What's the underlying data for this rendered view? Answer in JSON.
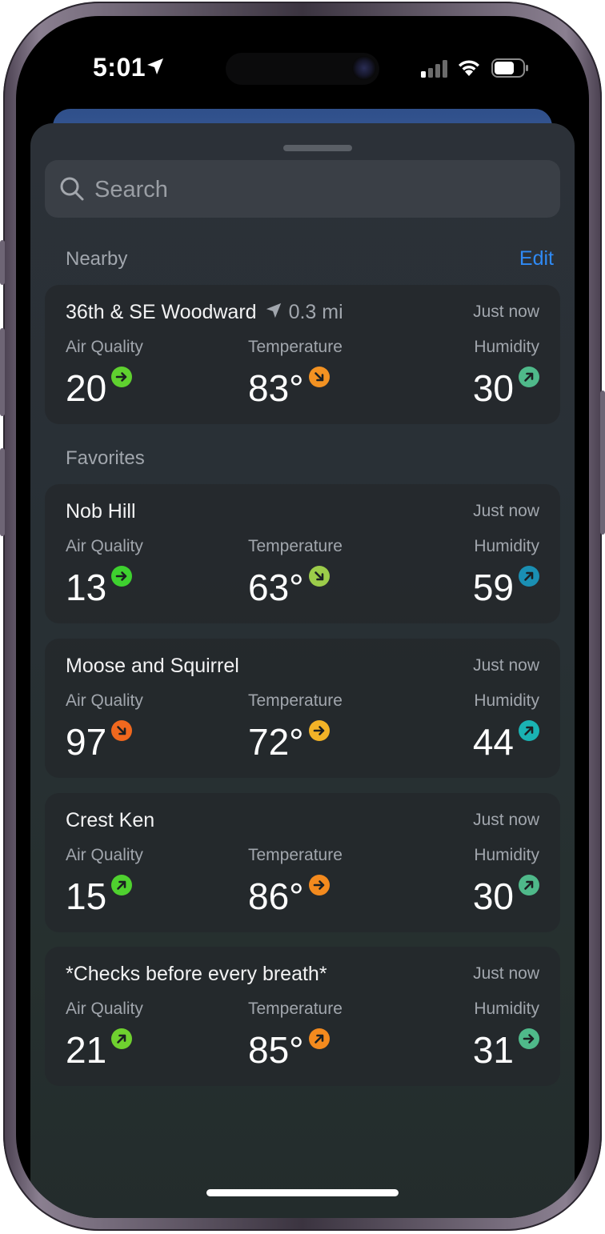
{
  "status": {
    "time": "5:01"
  },
  "search": {
    "placeholder": "Search"
  },
  "nearby": {
    "title": "Nearby",
    "edit_label": "Edit",
    "location": {
      "name": "36th & SE Woodward",
      "distance": "0.3 mi",
      "updated": "Just now",
      "air_quality": {
        "label": "Air Quality",
        "value": "20",
        "trend": "right",
        "color": "#5fd12f"
      },
      "temperature": {
        "label": "Temperature",
        "value": "83°",
        "trend": "down-right",
        "color": "#f39222"
      },
      "humidity": {
        "label": "Humidity",
        "value": "30",
        "trend": "up-right",
        "color": "#4fb98a"
      }
    }
  },
  "favorites": {
    "title": "Favorites",
    "items": [
      {
        "name": "Nob Hill",
        "updated": "Just now",
        "air_quality": {
          "label": "Air Quality",
          "value": "13",
          "trend": "right",
          "color": "#3ed12f"
        },
        "temperature": {
          "label": "Temperature",
          "value": "63°",
          "trend": "down-right",
          "color": "#9ccc4a"
        },
        "humidity": {
          "label": "Humidity",
          "value": "59",
          "trend": "up-right",
          "color": "#1a8fb3"
        }
      },
      {
        "name": "Moose and Squirrel",
        "updated": "Just now",
        "air_quality": {
          "label": "Air Quality",
          "value": "97",
          "trend": "down-right",
          "color": "#f0681e"
        },
        "temperature": {
          "label": "Temperature",
          "value": "72°",
          "trend": "right",
          "color": "#f2b327"
        },
        "humidity": {
          "label": "Humidity",
          "value": "44",
          "trend": "up-right",
          "color": "#1ab3b3"
        }
      },
      {
        "name": "Crest Ken",
        "updated": "Just now",
        "air_quality": {
          "label": "Air Quality",
          "value": "15",
          "trend": "up-right",
          "color": "#4fd12f"
        },
        "temperature": {
          "label": "Temperature",
          "value": "86°",
          "trend": "right",
          "color": "#f38a1e"
        },
        "humidity": {
          "label": "Humidity",
          "value": "30",
          "trend": "up-right",
          "color": "#4fb98a"
        }
      },
      {
        "name": "*Checks before every breath*",
        "updated": "Just now",
        "air_quality": {
          "label": "Air Quality",
          "value": "21",
          "trend": "up-right",
          "color": "#6fd12f"
        },
        "temperature": {
          "label": "Temperature",
          "value": "85°",
          "trend": "up-right",
          "color": "#f38a1e"
        },
        "humidity": {
          "label": "Humidity",
          "value": "31",
          "trend": "right",
          "color": "#4fb98a"
        }
      }
    ]
  }
}
